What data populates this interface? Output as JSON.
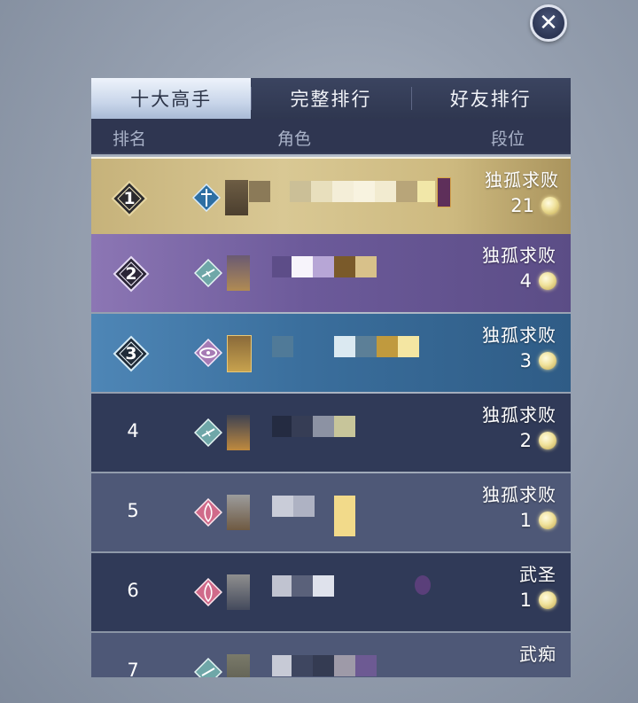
{
  "close_icon": "close-icon",
  "tabs": [
    {
      "label": "十大高手",
      "active": true
    },
    {
      "label": "完整排行",
      "active": false
    },
    {
      "label": "好友排行",
      "active": false
    }
  ],
  "columns": {
    "rank": "排名",
    "role": "角色",
    "tier": "段位"
  },
  "rows": [
    {
      "rank": "1",
      "tier": "独孤求败",
      "level": "21",
      "class_icon": "sword-class-icon",
      "style": "gold"
    },
    {
      "rank": "2",
      "tier": "独孤求败",
      "level": "4",
      "class_icon": "blade-class-icon",
      "style": "purple"
    },
    {
      "rank": "3",
      "tier": "独孤求败",
      "level": "3",
      "class_icon": "eye-class-icon",
      "style": "blue"
    },
    {
      "rank": "4",
      "tier": "独孤求败",
      "level": "2",
      "class_icon": "blade-class-icon",
      "style": "dark"
    },
    {
      "rank": "5",
      "tier": "独孤求败",
      "level": "1",
      "class_icon": "feather-class-icon",
      "style": "mid"
    },
    {
      "rank": "6",
      "tier": "武圣",
      "level": "1",
      "class_icon": "feather-class-icon",
      "style": "dark"
    },
    {
      "rank": "7",
      "tier": "武痴",
      "level": "",
      "class_icon": "blade-class-icon",
      "style": "mid"
    }
  ],
  "colors": {
    "gold_row": "#d9c894",
    "purple_row": "#6c5a9a",
    "blue_row": "#3a6e9c",
    "dark_row": "#303a58",
    "mid_row": "#4e5877",
    "coin": "#f0e29c"
  }
}
